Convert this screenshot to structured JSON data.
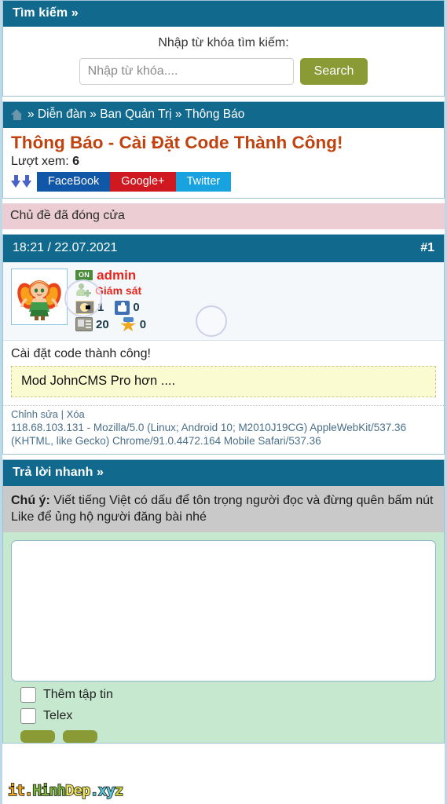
{
  "search": {
    "header": "Tìm kiếm »",
    "label": "Nhập từ khóa tìm kiếm:",
    "placeholder": "Nhập từ khóa....",
    "button": "Search"
  },
  "breadcrumb": {
    "home_icon": "home-icon",
    "path": "» Diễn đàn » Ban Quản Trị » Thông Báo"
  },
  "topic": {
    "title": "Thông Báo - Cài Đặt Code Thành Công!",
    "views_label": "Lượt xem:",
    "views_count": "6",
    "share": [
      {
        "label": "FaceBook",
        "color": "#1157a8"
      },
      {
        "label": "Google+",
        "color": "#cf1820"
      },
      {
        "label": "Twitter",
        "color": "#18a2e0"
      }
    ],
    "locked_notice": "Chủ đề đã đóng cửa"
  },
  "post": {
    "timestamp": "18:21 / 22.07.2021",
    "number": "#1",
    "user": {
      "online_badge": "ON",
      "name": "admin",
      "rank": "Giám sát",
      "stats": [
        {
          "icon": "coin-icon",
          "value": "1"
        },
        {
          "icon": "thumbs-up-icon",
          "value": "0"
        },
        {
          "icon": "posts-icon",
          "value": "20"
        },
        {
          "icon": "star-icon",
          "value": "0"
        }
      ]
    },
    "text": "Cài đặt code thành công!",
    "quote": "Mod JohnCMS Pro hơn ....",
    "edit_link": "Chỉnh sửa",
    "separator": "|",
    "delete_link": "Xóa",
    "useragent": "118.68.103.131 - Mozilla/5.0 (Linux; Android 10; M2010J19CG) AppleWebKit/537.36 (KHTML, like Gecko) Chrome/91.0.4472.164 Mobile Safari/537.36"
  },
  "reply": {
    "header": "Trả lời nhanh »",
    "note_prefix": "Chú ý:",
    "note_text": " Viết tiếng Việt có dấu để tôn trọng người đọc và đừng quên bấm nút Like để ủng hộ người đăng bài nhé",
    "textarea_value": "",
    "checkboxes": [
      {
        "label": "Thêm tập tin"
      },
      {
        "label": "Telex"
      }
    ],
    "buttons": [
      {
        "label": ""
      },
      {
        "label": ""
      }
    ]
  },
  "watermark": {
    "part1": "it.",
    "part2": "Hinh",
    "part3": "Dep",
    "part4": ".xy",
    "part5": "z"
  },
  "colors": {
    "header_teal": "#116a8e",
    "title_orange": "#c0420e",
    "olive": "#8a9a35",
    "reply_green": "#c6e8cf",
    "locked_pink": "#eccdd3",
    "quote_yellow": "#fbfbd2"
  }
}
